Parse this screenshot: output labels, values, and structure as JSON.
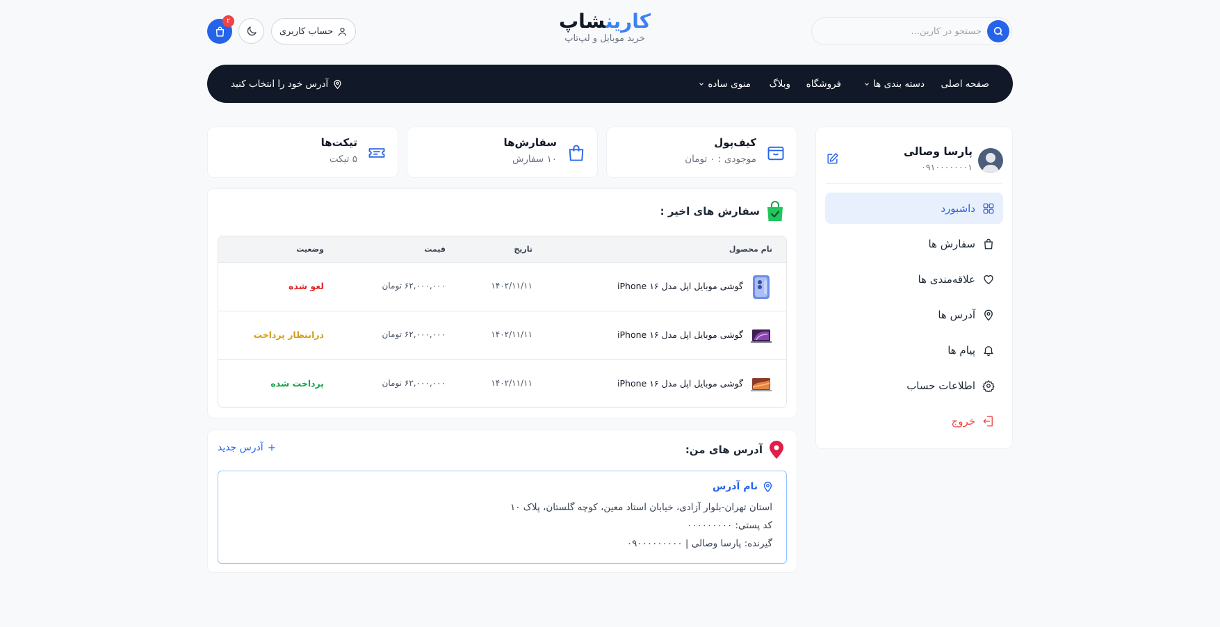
{
  "header": {
    "search_placeholder": "جستجو در کارین...",
    "logo_part1": "کارین",
    "logo_part2": "شاپ",
    "logo_sub": "خرید موبایل و لپ‌تاپ",
    "account_label": "حساب کاربری",
    "cart_count": "۲"
  },
  "nav": {
    "items": [
      {
        "label": "صفحه اصلی",
        "dropdown": false
      },
      {
        "label": "دسته بندی ها",
        "dropdown": true
      },
      {
        "label": "فروشگاه",
        "dropdown": false
      },
      {
        "label": "وبلاگ",
        "dropdown": false
      },
      {
        "label": "منوی ساده",
        "dropdown": true
      }
    ],
    "address_label": "آدرس خود را انتخاب کنید"
  },
  "profile": {
    "name": "پارسا وصالی",
    "phone": "۰۹۱۰۰۰۰۰۰۰۱"
  },
  "menu": [
    {
      "label": "داشبورد",
      "icon": "grid-icon",
      "active": true
    },
    {
      "label": "سفارش ها",
      "icon": "bag-icon"
    },
    {
      "label": "علاقه‌مندی ها",
      "icon": "heart-icon"
    },
    {
      "label": "آدرس ها",
      "icon": "location-icon"
    },
    {
      "label": "پیام ها",
      "icon": "bell-icon"
    },
    {
      "label": "اطلاعات حساب",
      "icon": "gear-icon"
    },
    {
      "label": "خروج",
      "icon": "logout-icon"
    }
  ],
  "stats": {
    "wallet": {
      "title": "کیف‌پول",
      "sub": "موجودی : ۰ تومان"
    },
    "orders": {
      "title": "سفارش‌ها",
      "sub": "۱۰ سفارش"
    },
    "tickets": {
      "title": "تیکت‌ها",
      "sub": "۵ تیکت"
    }
  },
  "recent_orders": {
    "title": "سفارش های اخیر :",
    "columns": {
      "product": "نام محصول",
      "date": "تاریخ",
      "price": "قیمت",
      "status": "وضعیت"
    },
    "rows": [
      {
        "product": "گوشی موبایل اپل مدل iPhone ۱۶",
        "date": "۱۴۰۲/۱۱/۱۱",
        "price": "۶۲,۰۰۰,۰۰۰ تومان",
        "status": "لغو شده",
        "status_color": "#dc2626"
      },
      {
        "product": "گوشی موبایل اپل مدل iPhone ۱۶",
        "date": "۱۴۰۲/۱۱/۱۱",
        "price": "۶۲,۰۰۰,۰۰۰ تومان",
        "status": "درانتظار پرداخت",
        "status_color": "#d4a017"
      },
      {
        "product": "گوشی موبایل اپل مدل iPhone ۱۶",
        "date": "۱۴۰۲/۱۱/۱۱",
        "price": "۶۲,۰۰۰,۰۰۰ تومان",
        "status": "پرداخت شده",
        "status_color": "#16a34a"
      }
    ]
  },
  "addresses": {
    "title": "آدرس های من:",
    "add_label": "آدرس جدید",
    "item": {
      "name": "نام آدرس",
      "line": "استان تهران-بلوار آزادی، خیابان استاد معین، کوچه گلستان، پلاک ۱۰",
      "postal": "کد پستی: ۰۰۰۰۰۰۰۰۰",
      "receiver": "گیرنده: پارسا وصالی | ۰۹۰۰۰۰۰۰۰۰۰"
    }
  },
  "colors": {
    "accent": "#2563eb",
    "nav_bg": "#111827",
    "danger": "#ef4444"
  }
}
